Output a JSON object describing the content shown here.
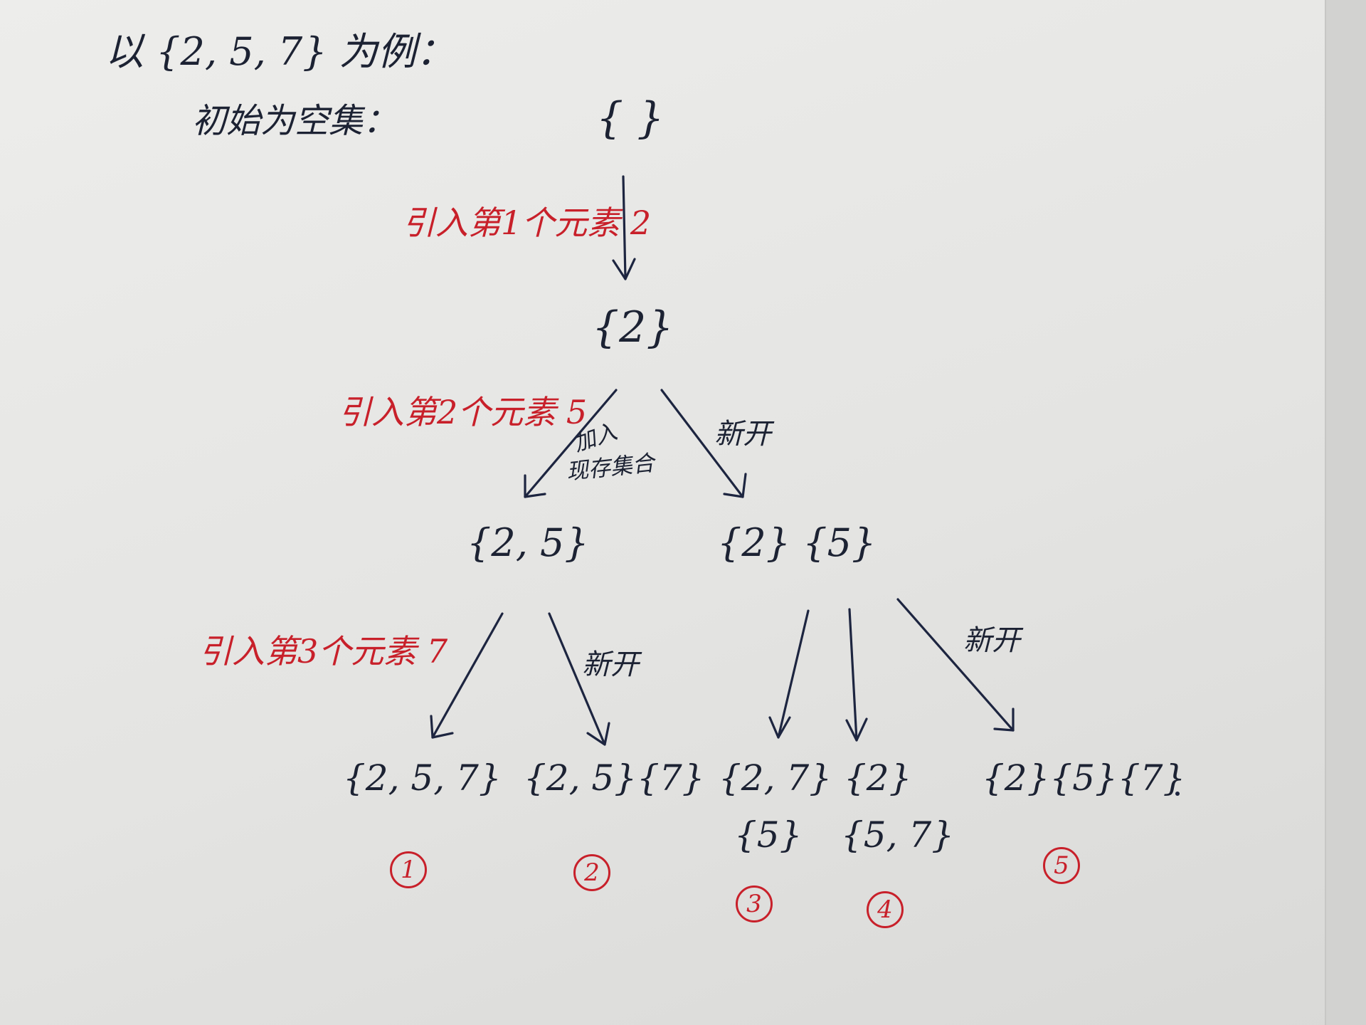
{
  "title": "以 {2, 5, 7} 为例：",
  "initial_label": "初始为空集：",
  "steps": [
    "引入第1个元素 2",
    "引入第2个元素 5",
    "引入第3个元素 7"
  ],
  "sets": {
    "empty": "{ }",
    "s_2": "{2}",
    "s_25": "{2, 5}",
    "s_2__5": "{2} {5}",
    "s_257": "{2, 5, 7}",
    "s_25__7": "{2, 5}{7}",
    "s_27": "{2, 7}",
    "s_5": "{5}",
    "s_2b": "{2}",
    "s_57": "{5, 7}",
    "s_2__5__7": "{2}{5}{7}"
  },
  "edge_labels": {
    "join_line1": "加入",
    "join_line2": "现存集合",
    "new_a": "新开",
    "new_b": "新开",
    "new_c": "新开"
  },
  "result_numbers": [
    "1",
    "2",
    "3",
    "4",
    "5"
  ],
  "colors": {
    "ink": "#1d2540",
    "red": "#c8202a"
  }
}
